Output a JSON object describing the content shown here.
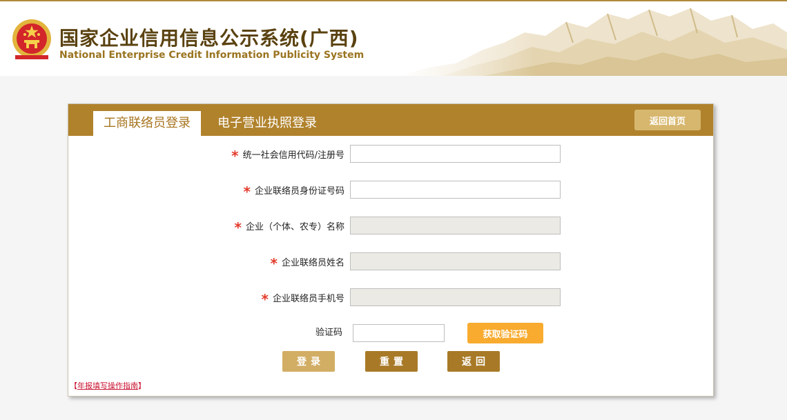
{
  "header": {
    "title_cn": "国家企业信用信息公示系统(广西)",
    "title_en": "National Enterprise Credit Information Publicity System"
  },
  "tabs": [
    {
      "label": "工商联络员登录",
      "active": true
    },
    {
      "label": "电子营业执照登录",
      "active": false
    }
  ],
  "home_button": "返回首页",
  "form": {
    "required_mark": "*",
    "fields": [
      {
        "label": "统一社会信用代码/注册号",
        "value": "",
        "disabled": false
      },
      {
        "label": "企业联络员身份证号码",
        "value": "",
        "disabled": false
      },
      {
        "label": "企业（个体、农专）名称",
        "value": "",
        "disabled": true
      },
      {
        "label": "企业联络员姓名",
        "value": "",
        "disabled": true
      },
      {
        "label": "企业联络员手机号",
        "value": "",
        "disabled": true
      }
    ],
    "captcha_label": "验证码",
    "captcha_value": "",
    "get_code_button": "获取验证码"
  },
  "actions": {
    "login": "登录",
    "reset": "重置",
    "back": "返回"
  },
  "guide_link": {
    "open": "【",
    "text": "年报填写操作指南",
    "close": "】"
  },
  "colors": {
    "brand_gold": "#b0822c",
    "light_gold": "#d2ad64",
    "orange": "#f8ab2f",
    "required_red": "#e23a2a",
    "link_red": "#c8102e",
    "disabled_bg": "#ebeae4"
  },
  "icons": {
    "emblem": "national-emblem-icon",
    "background": "mountain-landscape-illustration"
  }
}
